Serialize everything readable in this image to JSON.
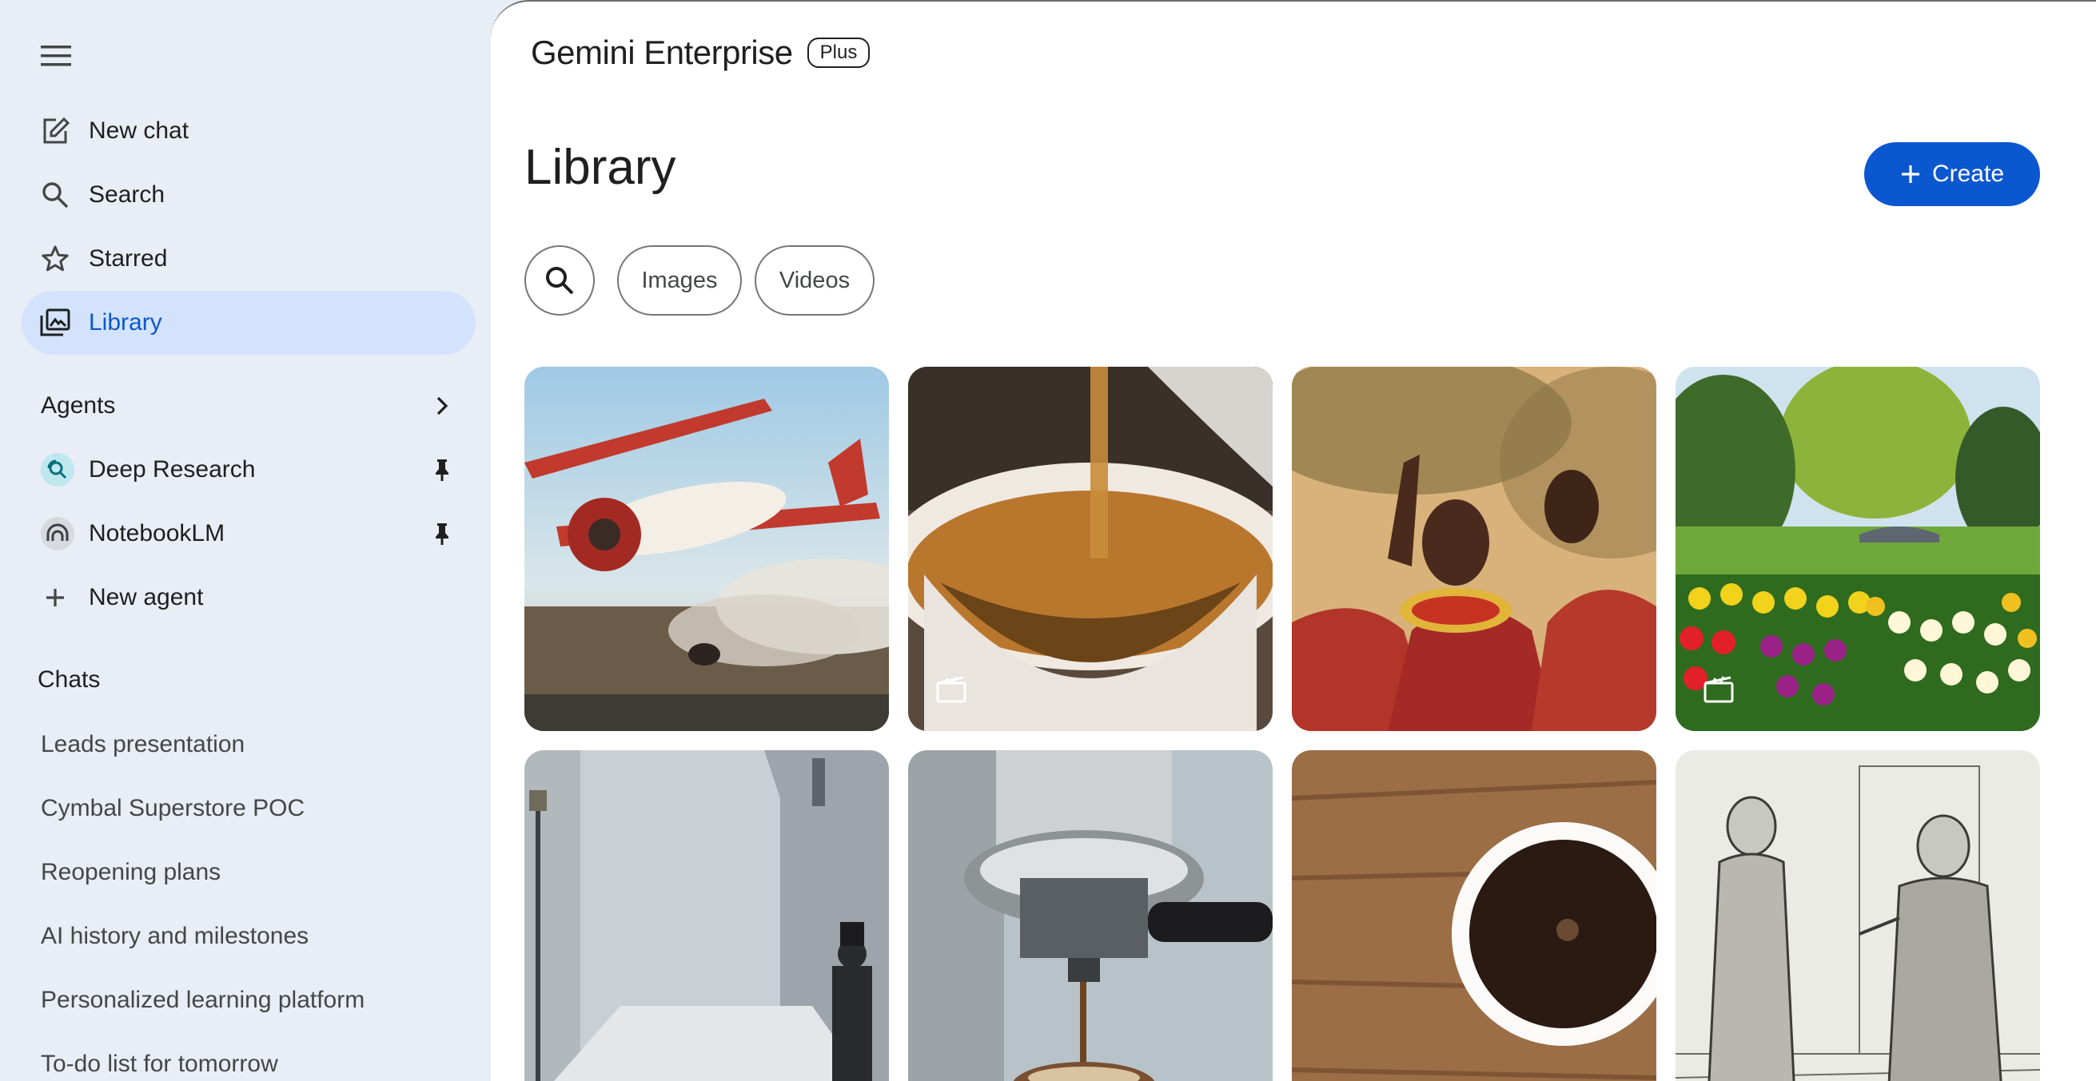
{
  "sidebar": {
    "nav": [
      {
        "label": "New chat",
        "icon": "edit-icon"
      },
      {
        "label": "Search",
        "icon": "search-icon"
      },
      {
        "label": "Starred",
        "icon": "star-icon"
      },
      {
        "label": "Library",
        "icon": "library-icon",
        "active": true
      }
    ],
    "agents_title": "Agents",
    "agents": [
      {
        "label": "Deep Research",
        "icon": "deep-research-icon"
      },
      {
        "label": "NotebookLM",
        "icon": "notebooklm-icon"
      }
    ],
    "new_agent_label": "New agent",
    "chats_title": "Chats",
    "chats": [
      "Leads presentation",
      "Cymbal Superstore POC",
      "Reopening plans",
      "AI history and milestones",
      "Personalized learning platform",
      "To-do list for tomorrow"
    ]
  },
  "header": {
    "brand": "Gemini Enterprise",
    "badge": "Plus"
  },
  "main": {
    "title": "Library",
    "create_label": "Create",
    "filters": [
      "Images",
      "Videos"
    ]
  },
  "gallery": [
    {
      "subject": "red biplane over crowd",
      "video": false
    },
    {
      "subject": "tea pouring into glass cup",
      "video": true
    },
    {
      "subject": "maasai people celebrating",
      "video": false
    },
    {
      "subject": "tulip garden with willow and bridge",
      "video": true
    },
    {
      "subject": "foggy victorian street",
      "video": false
    },
    {
      "subject": "espresso machine brewing",
      "video": false
    },
    {
      "subject": "coffee cup on wooden table",
      "video": false
    },
    {
      "subject": "sketch of two gentlemen talking",
      "video": false
    }
  ],
  "colors": {
    "sidebar_bg": "#e8edf6",
    "active_bg": "#d3e3fd",
    "accent": "#0b57d0"
  }
}
